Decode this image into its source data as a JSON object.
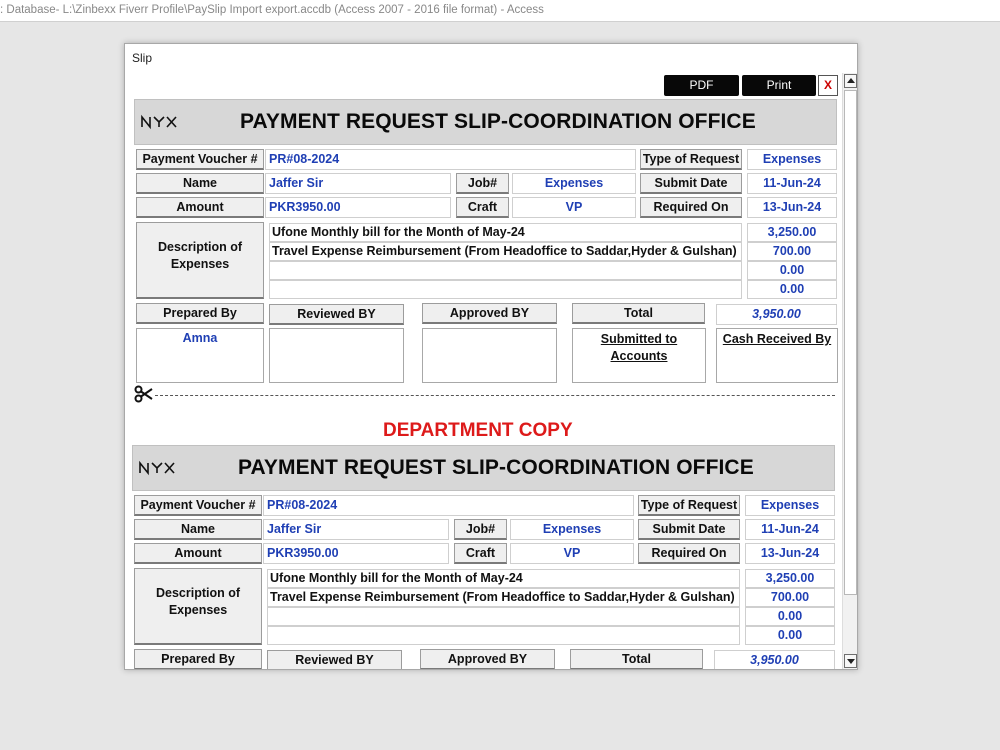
{
  "app": {
    "title_bar": ": Database- L:\\Zinbexx Fiverr Profile\\PaySlip Import export.accdb (Access 2007 - 2016 file format) - Access"
  },
  "form": {
    "caption": "Slip",
    "buttons": {
      "pdf": "PDF",
      "print": "Print",
      "close": "X"
    }
  },
  "colors": {
    "value_text": "#1f3fb4",
    "department_copy": "#dd1a1a",
    "header_bg": "#d7d7d7"
  },
  "slip": {
    "logo": "NYX",
    "title": "PAYMENT REQUEST SLIP-COORDINATION OFFICE",
    "labels": {
      "voucher": "Payment Voucher #",
      "name": "Name",
      "amount": "Amount",
      "job": "Job#",
      "craft": "Craft",
      "type_of_request": "Type of Request",
      "submit_date": "Submit Date",
      "required_on": "Required On",
      "description": "Description of Expenses",
      "prepared_by": "Prepared By",
      "reviewed_by": "Reviewed BY",
      "approved_by": "Approved BY",
      "total": "Total",
      "submitted_to": "Submitted to Accounts",
      "cash_received_by": "Cash Received By"
    },
    "values": {
      "voucher": "PR#08-2024",
      "name": "Jaffer Sir",
      "amount": "PKR3950.00",
      "job": "Expenses",
      "craft": "VP",
      "type_of_request": "Expenses",
      "submit_date": "11-Jun-24",
      "required_on": "13-Jun-24",
      "prepared_by": "Amna",
      "total": "3,950.00"
    },
    "expenses": [
      {
        "description": "Ufone Monthly bill for the Month of May-24",
        "amount": "3,250.00"
      },
      {
        "description": "Travel Expense Reimbursement (From Headoffice to Saddar,Hyder & Gulshan)",
        "amount": "700.00"
      },
      {
        "description": "",
        "amount": "0.00"
      },
      {
        "description": "",
        "amount": "0.00"
      }
    ]
  },
  "department_copy": {
    "label": "DEPARTMENT COPY"
  }
}
